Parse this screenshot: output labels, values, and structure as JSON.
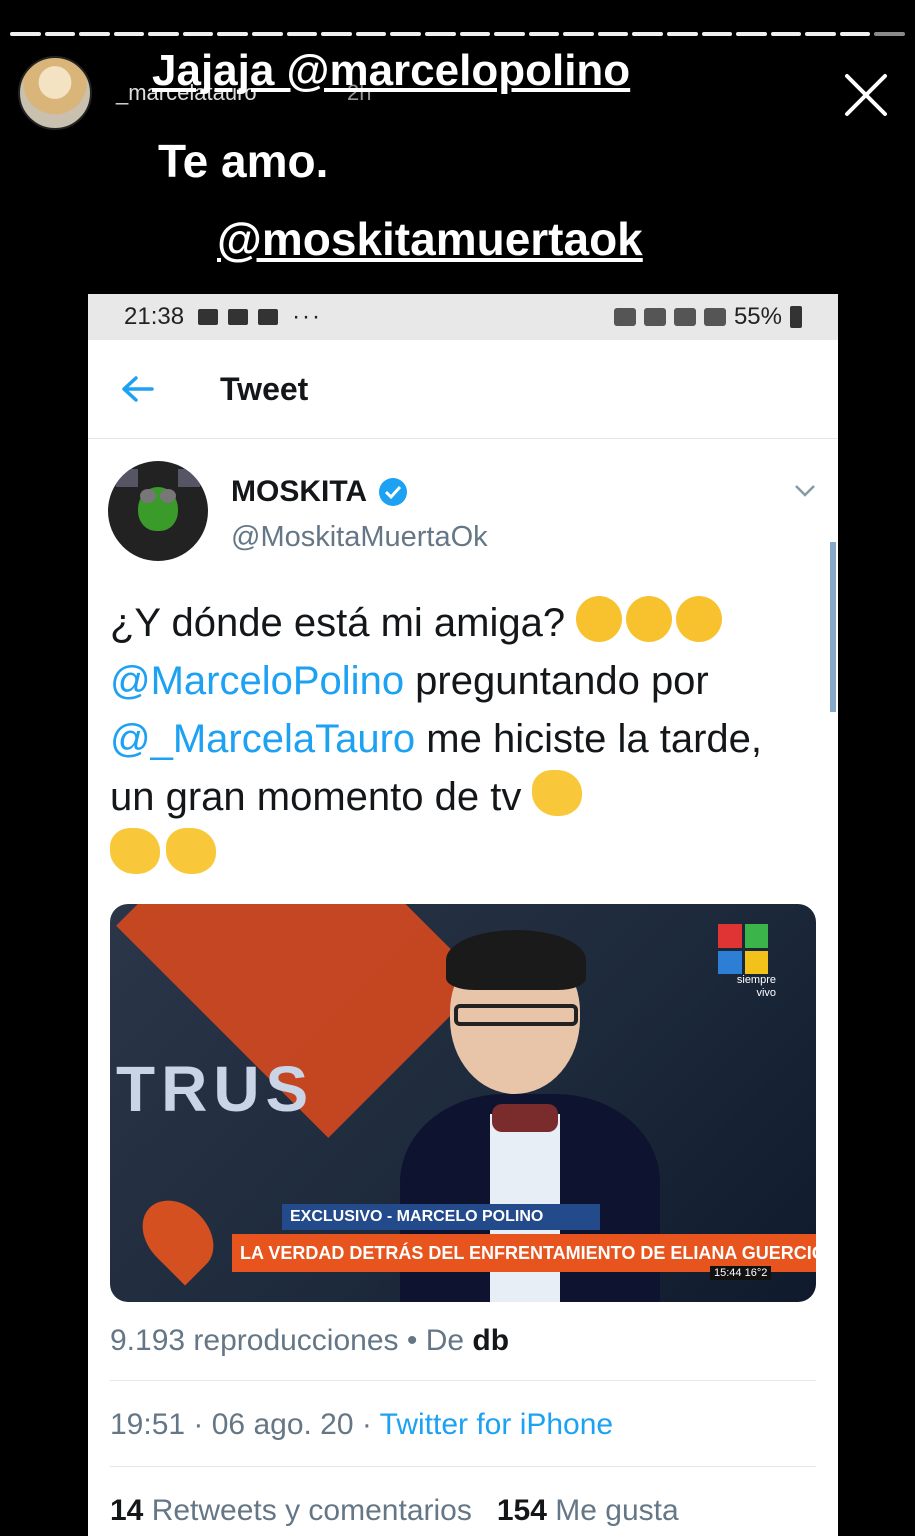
{
  "story": {
    "username": "_marcelatauro",
    "time_ago": "2h",
    "captions": [
      "Jajaja @marcelopolino",
      "Te  amo.",
      "@moskitamuertaok"
    ],
    "progress_segments": 26,
    "progress_filled": 25
  },
  "phone_status": {
    "time": "21:38",
    "dots": "···",
    "battery": "55%"
  },
  "tweet_view": {
    "nav_title": "Tweet",
    "author": {
      "name": "MOSKITA",
      "handle": "@MoskitaMuertaOk"
    },
    "text": {
      "line1": "¿Y dónde está mi amiga?",
      "mention1": "@MarceloPolino",
      "line2": " preguntando por",
      "mention2": "@_MarcelaTauro",
      "line3": " me hiciste la tarde, un gran momento de tv"
    },
    "media": {
      "backdrop_text": "TRUS",
      "channel_text_1": "siempre",
      "channel_text_2": "vivo",
      "chyron_top": "EXCLUSIVO - MARCELO POLINO",
      "chyron_main": "LA VERDAD DETRÁS DEL ENFRENTAMIENTO DE ELIANA GUERCIO Y MARCELO POLINO",
      "clock": "15:44 16°2"
    },
    "views": {
      "count_label": "9.193 reproducciones",
      "sep": " • De ",
      "from": "db"
    },
    "meta": {
      "time": "19:51",
      "date": "06 ago. 20",
      "source": "Twitter for iPhone"
    },
    "stats": {
      "retweets": "14",
      "retweets_label": " Retweets y comentarios",
      "likes": "154",
      "likes_label": " Me gusta"
    }
  },
  "colors": {
    "twitter_blue": "#1da1f2",
    "text": "#14171a",
    "secondary": "#657786"
  }
}
